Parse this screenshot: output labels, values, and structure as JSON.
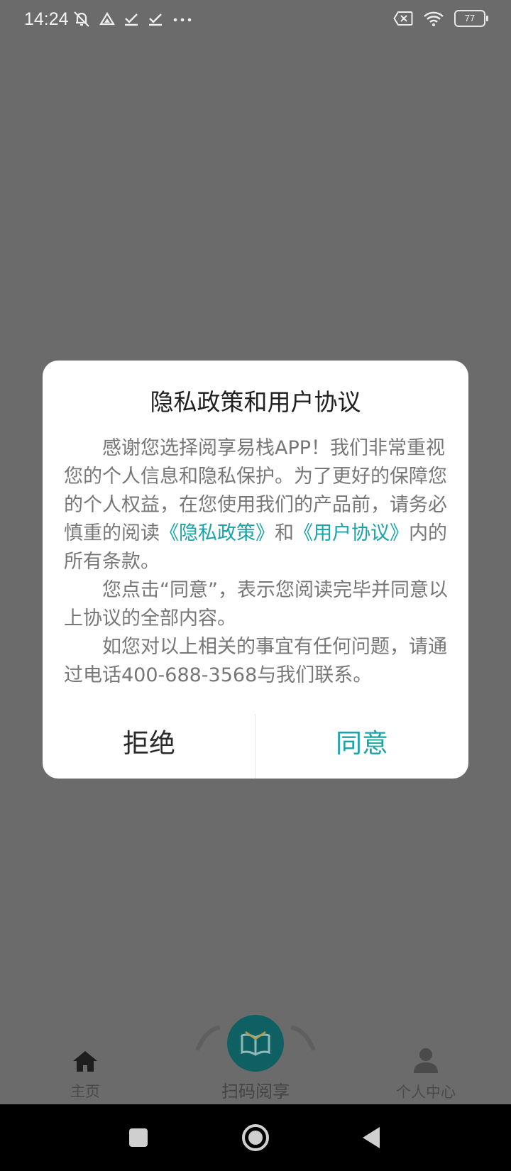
{
  "status_bar": {
    "time": "14:24",
    "left_icons": [
      "mute-notification-icon",
      "drive-icon",
      "check-icon",
      "check-icon",
      "more-dots-icon"
    ],
    "right_icons": [
      "no-sim-icon",
      "wifi-icon"
    ],
    "battery": "77"
  },
  "dialog": {
    "title": "隐私政策和用户协议",
    "para1_text1": "感谢您选择阅享易栈APP！我们非常重视您的个人信息和隐私保护。为了更好的保障您的个人权益，在您使用我们的产品前，请务必慎重的阅读",
    "privacy_link": "《隐私政策》",
    "para1_text2": "和",
    "agreement_link": "《用户协议》",
    "para1_text3": "内的所有条款。",
    "para2": "您点击“同意”，表示您阅读完毕并同意以上协议的全部内容。",
    "para3": "如您对以上相关的事宜有任何问题，请通过电话400-688-3568与我们联系。",
    "reject_label": "拒绝",
    "agree_label": "同意"
  },
  "tabbar": {
    "home_label": "主页",
    "scan_label": "扫码阅享",
    "profile_label": "个人中心"
  },
  "navbar": {
    "icons": [
      "recents-square-icon",
      "home-circle-icon",
      "back-triangle-icon"
    ]
  },
  "colors": {
    "overlay": "#6b6b6b",
    "accent": "#1aa3a8"
  }
}
